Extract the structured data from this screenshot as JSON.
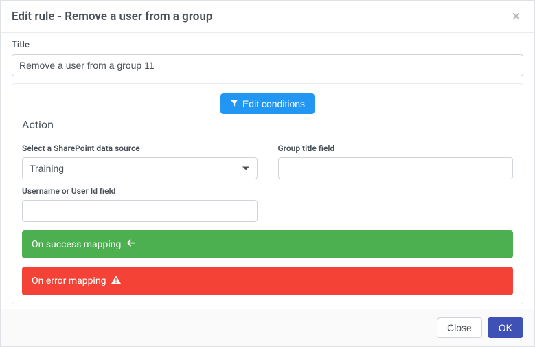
{
  "header": {
    "title": "Edit rule - Remove a user from a group"
  },
  "form": {
    "title_label": "Title",
    "title_value": "Remove a user from a group 11"
  },
  "card": {
    "edit_conditions_label": "Edit conditions",
    "action_heading": "Action",
    "datasource_label": "Select a SharePoint data source",
    "datasource_value": "Training",
    "group_title_label": "Group title field",
    "group_title_value": "",
    "username_label": "Username or User Id field",
    "username_value": "",
    "success_mapping_label": "On success mapping",
    "error_mapping_label": "On error mapping"
  },
  "footer": {
    "close_label": "Close",
    "ok_label": "OK"
  }
}
